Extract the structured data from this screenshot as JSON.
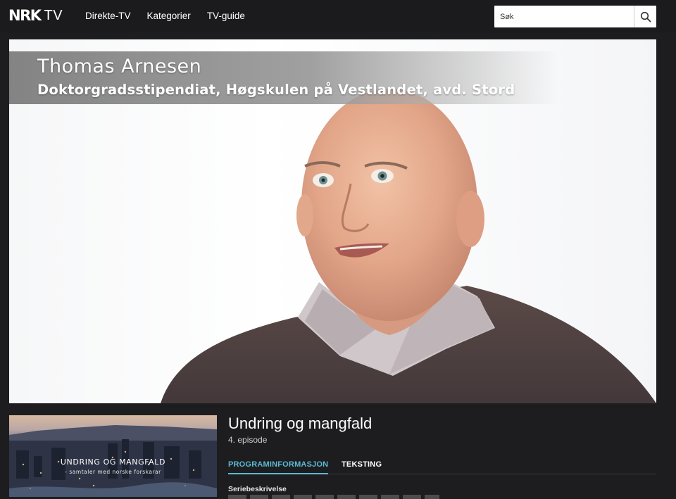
{
  "brand": {
    "logo_main": "NRK",
    "logo_sub": "TV"
  },
  "nav": {
    "items": [
      "Direkte-TV",
      "Kategorier",
      "TV-guide"
    ]
  },
  "search": {
    "placeholder": "Søk",
    "icon": "magnifier-icon"
  },
  "player": {
    "lower_third": {
      "name": "Thomas Arnesen",
      "role": "Doktorgradsstipendiat, Høgskulen på Vestlandet, avd. Stord"
    }
  },
  "program": {
    "thumbnail": {
      "title": "UNDRING OG MANGFALD",
      "subtitle": "- samtaler med norske forskarar"
    },
    "title": "Undring og mangfald",
    "episode": "4. episode",
    "tabs": [
      "PROGRAMINFORMASJON",
      "TEKSTING"
    ],
    "active_tab": "PROGRAMINFORMASJON",
    "section_label": "Seriebeskrivelse"
  },
  "colors": {
    "background": "#1d1d1f",
    "accent": "#5bbad5",
    "text": "#ffffff"
  }
}
